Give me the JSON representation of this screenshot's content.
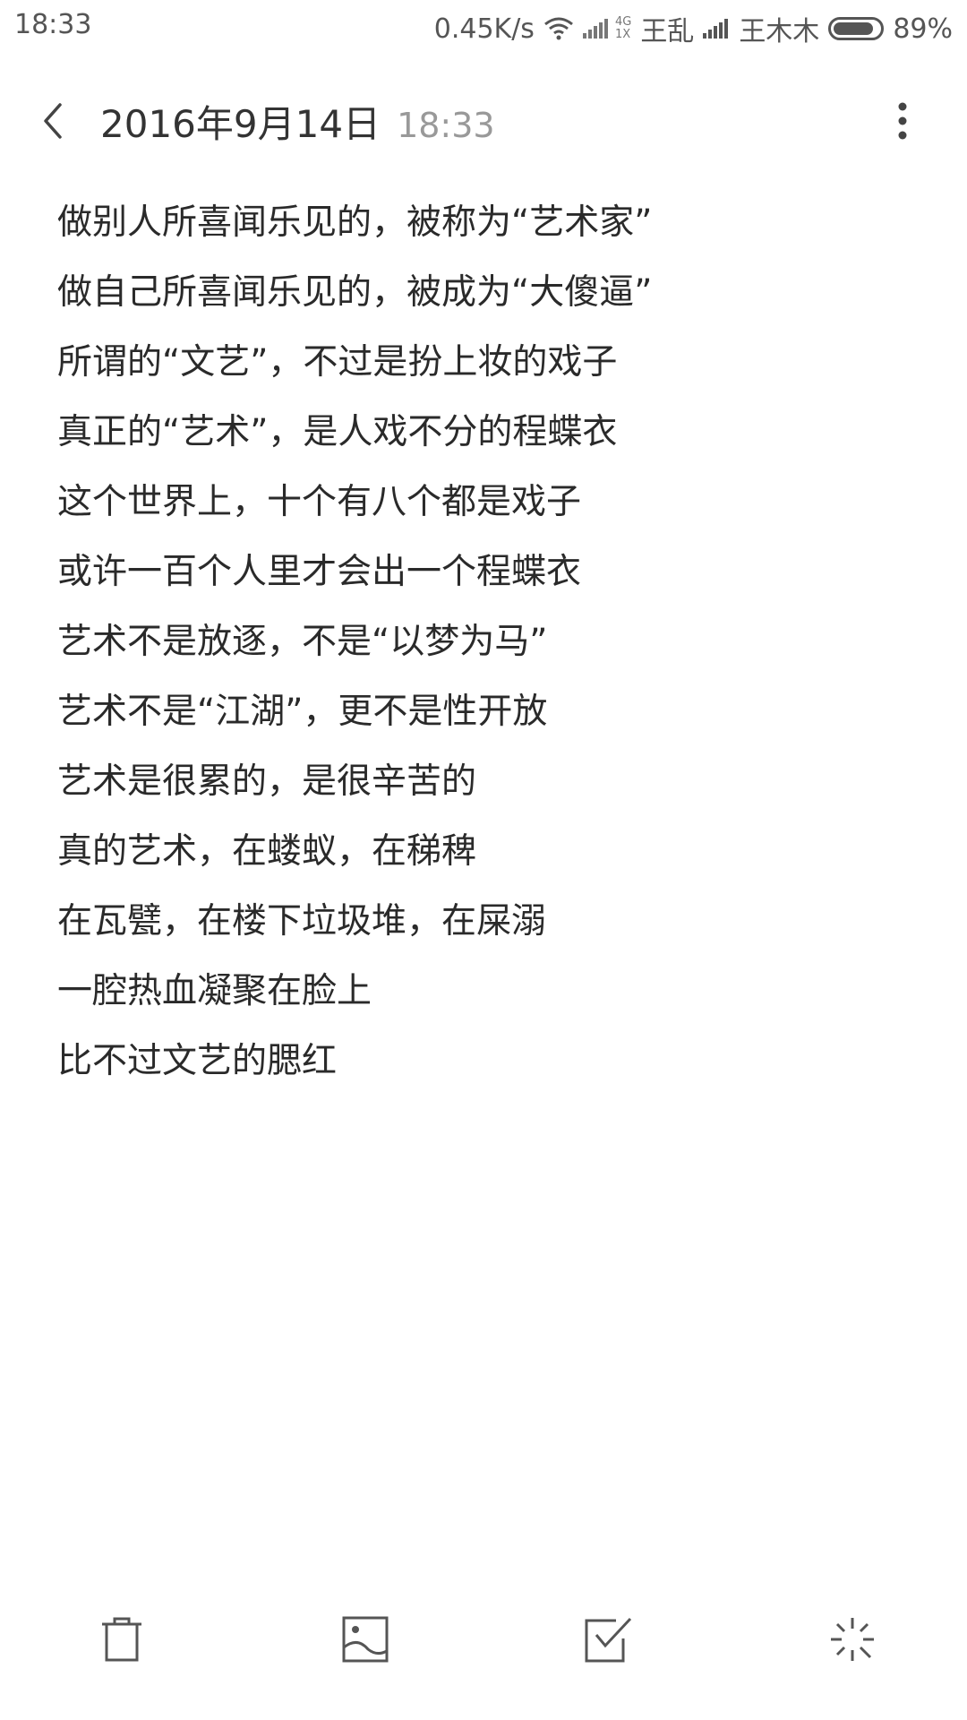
{
  "status_bar": {
    "time": "18:33",
    "network_speed": "0.45K/s",
    "network_type_top": "4G",
    "network_type_bottom": "1X",
    "carrier_1": "王乱",
    "carrier_2": "王木木",
    "battery_percent": "89%",
    "battery_level": 0.89
  },
  "header": {
    "date": "2016年9月14日",
    "time": "18:33"
  },
  "note": {
    "lines": [
      "做别人所喜闻乐见的，被称为“艺术家”",
      "做自己所喜闻乐见的，被成为“大傻逼”",
      "所谓的“文艺”，不过是扮上妆的戏子",
      "真正的“艺术”，是人戏不分的程蝶衣",
      "这个世界上，十个有八个都是戏子",
      "或许一百个人里才会出一个程蝶衣",
      "艺术不是放逐，不是“以梦为马”",
      "艺术不是“江湖”，更不是性开放",
      "艺术是很累的，是很辛苦的",
      "真的艺术，在蝼蚁，在稊稗",
      "在瓦甓，在楼下垃圾堆，在屎溺",
      "一腔热血凝聚在脸上",
      "比不过文艺的腮红"
    ]
  },
  "icons": {
    "back": "chevron-left-icon",
    "more": "more-vertical-icon",
    "delete": "trash-icon",
    "image": "image-icon",
    "checklist": "checkbox-icon",
    "magic": "sparkle-icon"
  }
}
